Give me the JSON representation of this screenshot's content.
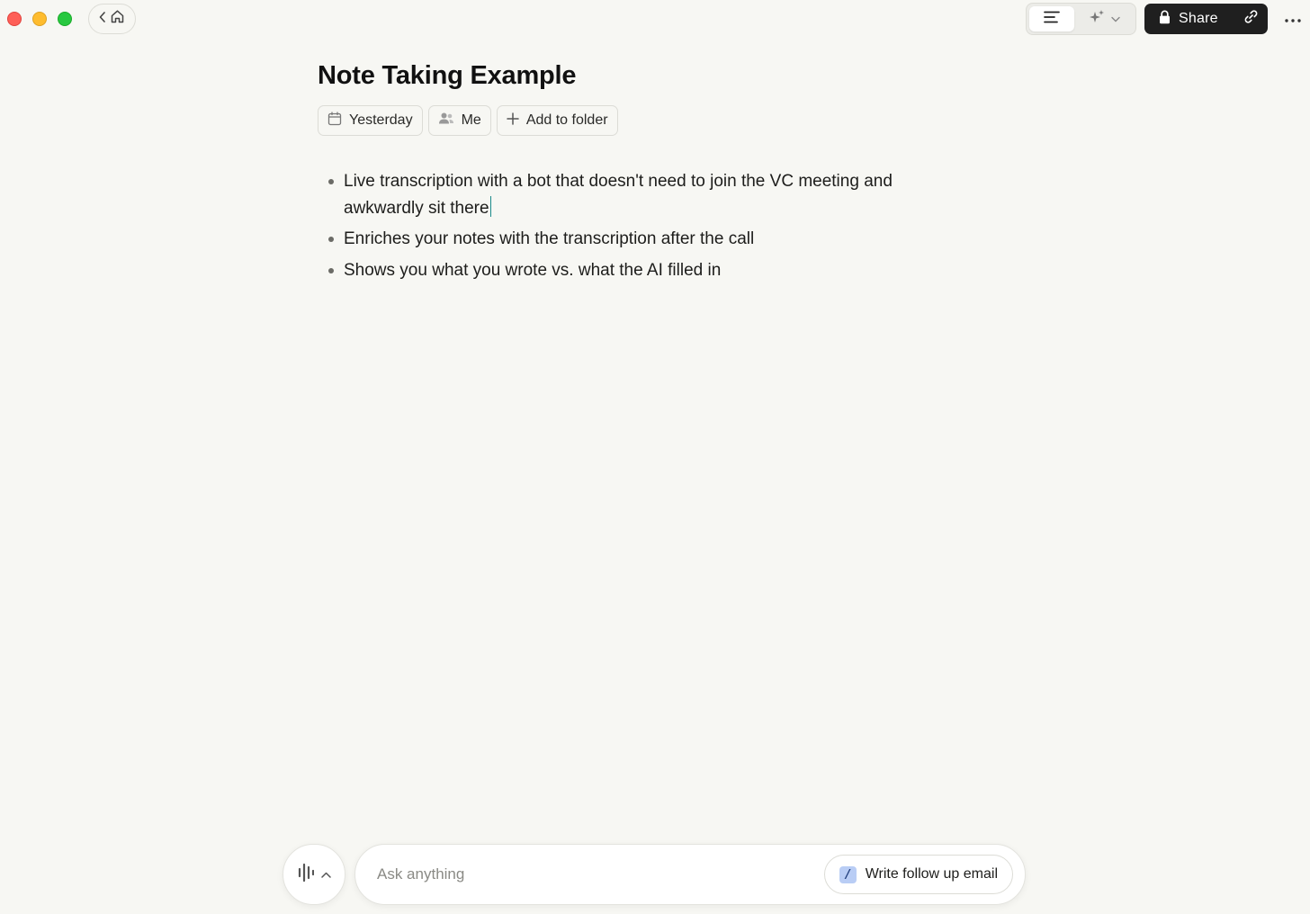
{
  "window": {
    "buttons": [
      "close",
      "minimize",
      "maximize"
    ]
  },
  "toolbar": {
    "back_icon": "chevron-left-icon",
    "home_icon": "home-icon",
    "notes_view_icon": "text-align-left-icon",
    "ai_view_icon": "sparkles-icon",
    "share_label": "Share",
    "lock_icon": "lock-icon",
    "link_icon": "link-icon",
    "more_icon": "ellipsis-icon"
  },
  "note": {
    "title": "Note Taking Example",
    "chips": {
      "date": "Yesterday",
      "attendees": "Me",
      "folder": "Add to folder"
    },
    "bullets": [
      "Live transcription with a bot that doesn't need to join the VC meeting and awkwardly sit there",
      "Enriches your notes with the transcription after the call",
      "Shows you what you wrote vs. what the AI filled in"
    ]
  },
  "bottom_bar": {
    "ask_placeholder": "Ask anything",
    "recipe_shortcut": "/",
    "recipe_label": "Write follow up email"
  },
  "colors": {
    "background": "#f7f7f3",
    "share_button": "#1f1f1f",
    "caret": "#1a8a8a",
    "recipe_badge": "#b9cdf5"
  }
}
